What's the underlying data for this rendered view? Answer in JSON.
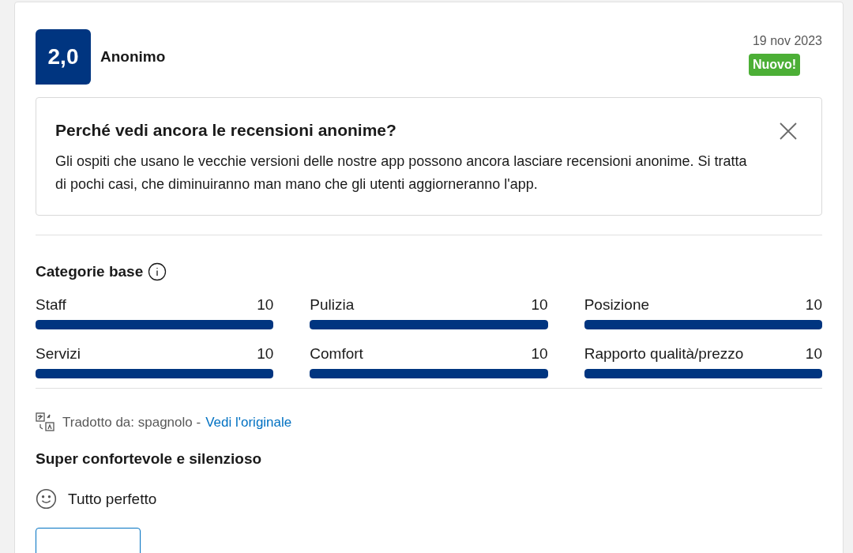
{
  "review": {
    "score": "2,0",
    "author": "Anonimo",
    "date": "19 nov 2023",
    "badge": "Nuovo!"
  },
  "notice": {
    "title": "Perché vedi ancora le recensioni anonime?",
    "text": "Gli ospiti che usano le vecchie versioni delle nostre app possono ancora lasciare recensioni anonime. Si tratta di pochi casi, che diminuiranno man mano che gli utenti aggiorneranno l'app."
  },
  "categories": {
    "title": "Categorie base",
    "items": [
      {
        "label": "Staff",
        "score": "10",
        "level": 1
      },
      {
        "label": "Pulizia",
        "score": "10",
        "level": 1
      },
      {
        "label": "Posizione",
        "score": "10",
        "level": 1
      },
      {
        "label": "Servizi",
        "score": "10",
        "level": 1
      },
      {
        "label": "Comfort",
        "score": "10",
        "level": 1
      },
      {
        "label": "Rapporto qualità/prezzo",
        "score": "10",
        "level": 1
      }
    ]
  },
  "translation": {
    "text": "Tradotto da: spagnolo -",
    "link": "Vedi l'originale"
  },
  "review_title": "Super confortevole e silenzioso",
  "positive": "Tutto perfetto"
}
